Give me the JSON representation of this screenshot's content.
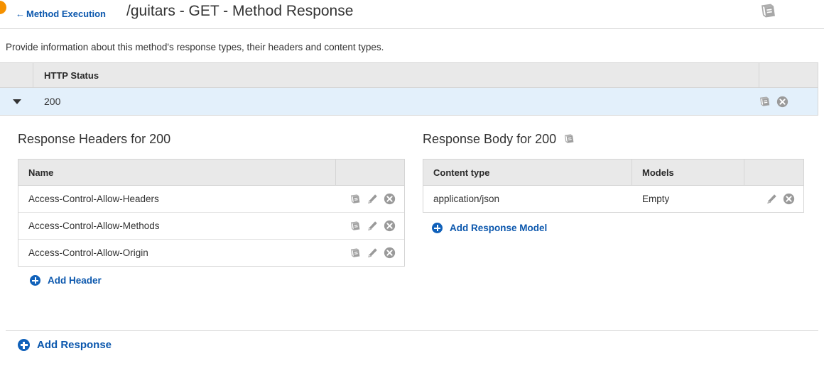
{
  "header": {
    "breadcrumb_arrow": "←",
    "breadcrumb_label": "Method Execution",
    "title": "/guitars - GET - Method Response",
    "doc_icon": "book-icon"
  },
  "description": "Provide information about this method's response types, their headers and content types.",
  "status_table": {
    "columns": [
      "",
      "HTTP Status",
      ""
    ],
    "rows": [
      {
        "expanded": true,
        "toggle_icon": "caret-down-icon",
        "status": "200",
        "actions": [
          "book-icon",
          "delete-icon"
        ]
      }
    ]
  },
  "headers_section": {
    "heading": "Response Headers for 200",
    "columns": [
      "Name",
      ""
    ],
    "rows": [
      {
        "name": "Access-Control-Allow-Headers",
        "actions": [
          "book-icon",
          "edit-icon",
          "delete-icon"
        ]
      },
      {
        "name": "Access-Control-Allow-Methods",
        "actions": [
          "book-icon",
          "edit-icon",
          "delete-icon"
        ]
      },
      {
        "name": "Access-Control-Allow-Origin",
        "actions": [
          "book-icon",
          "edit-icon",
          "delete-icon"
        ]
      }
    ],
    "add_label": "Add Header"
  },
  "body_section": {
    "heading": "Response Body for 200",
    "heading_icon": "book-icon",
    "columns": [
      "Content type",
      "Models",
      ""
    ],
    "rows": [
      {
        "content_type": "application/json",
        "model": "Empty",
        "actions": [
          "edit-icon",
          "delete-icon"
        ]
      }
    ],
    "add_label": "Add Response Model"
  },
  "footer": {
    "add_label": "Add Response"
  },
  "colors": {
    "link_blue": "#0b57ad",
    "accent_blue": "#1061ba",
    "row_highlight": "#e3f0fb",
    "table_header_grey": "#e9e9e9",
    "border_grey": "#d5d5d5",
    "icon_grey": "#9a9a9a",
    "brand_orange": "#f59100"
  }
}
